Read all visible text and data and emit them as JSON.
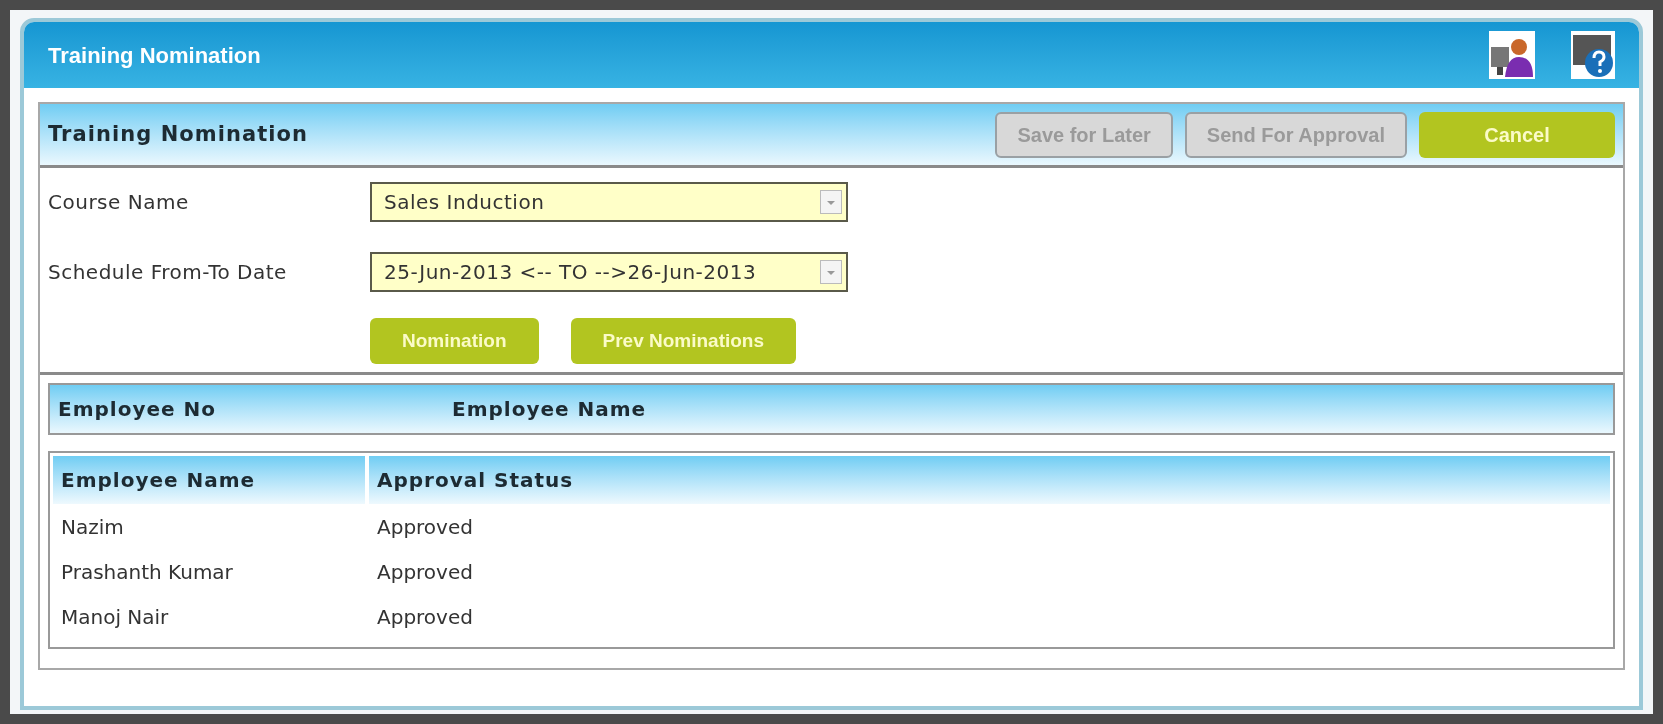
{
  "window": {
    "title": "Training Nomination"
  },
  "panel": {
    "title": "Training Nomination",
    "buttons": [
      {
        "label": "Save for Later",
        "disabled": true
      },
      {
        "label": "Send For Approval",
        "disabled": true
      },
      {
        "label": "Cancel",
        "disabled": false
      }
    ]
  },
  "form": {
    "fields": [
      {
        "label": "Course Name",
        "value": "Sales Induction"
      },
      {
        "label": "Schedule From-To Date",
        "value": "25-Jun-2013 <-- TO -->26-Jun-2013"
      }
    ],
    "buttons": [
      "Nomination",
      "Prev Nominations"
    ]
  },
  "employee_header": [
    "Employee No",
    "Employee Name"
  ],
  "table": {
    "columns": [
      "Employee Name",
      "Approval Status"
    ],
    "rows": [
      [
        "Nazim",
        "Approved"
      ],
      [
        "Prashanth Kumar",
        "Approved"
      ],
      [
        "Manoj Nair",
        "Approved"
      ]
    ]
  }
}
